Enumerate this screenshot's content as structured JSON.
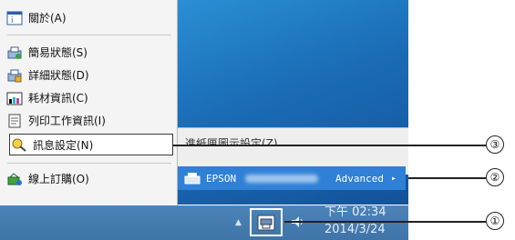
{
  "menu": {
    "items": [
      {
        "label": "關於(A)",
        "icon": "info-window-icon"
      },
      {
        "label": "簡易狀態(S)",
        "icon": "printer-status-icon"
      },
      {
        "label": "詳細狀態(D)",
        "icon": "printer-detail-icon"
      },
      {
        "label": "耗材資訊(C)",
        "icon": "ink-icon"
      },
      {
        "label": "列印工作資訊(I)",
        "icon": "document-icon"
      },
      {
        "label": "訊息設定(N)",
        "icon": "search-settings-icon"
      },
      {
        "label": "線上訂購(O)",
        "icon": "shop-icon"
      }
    ]
  },
  "submenu": {
    "partial_item": "進紙匣圖示設定(Z)",
    "epson_row": {
      "prefix": "EPSON",
      "suffix": "Advanced",
      "arrow": "▸"
    }
  },
  "tray": {
    "time": "下午 02:34",
    "date": "2014/3/24",
    "arrow": "▲"
  },
  "callouts": [
    {
      "label": "③"
    },
    {
      "label": "②"
    },
    {
      "label": "①"
    }
  ],
  "colors": {
    "menu_bg": "#f4f4f4",
    "desktop_blue": "#1a6cb5",
    "highlight_blue": "#2f80d6",
    "taskbar": "#4a80b4"
  }
}
